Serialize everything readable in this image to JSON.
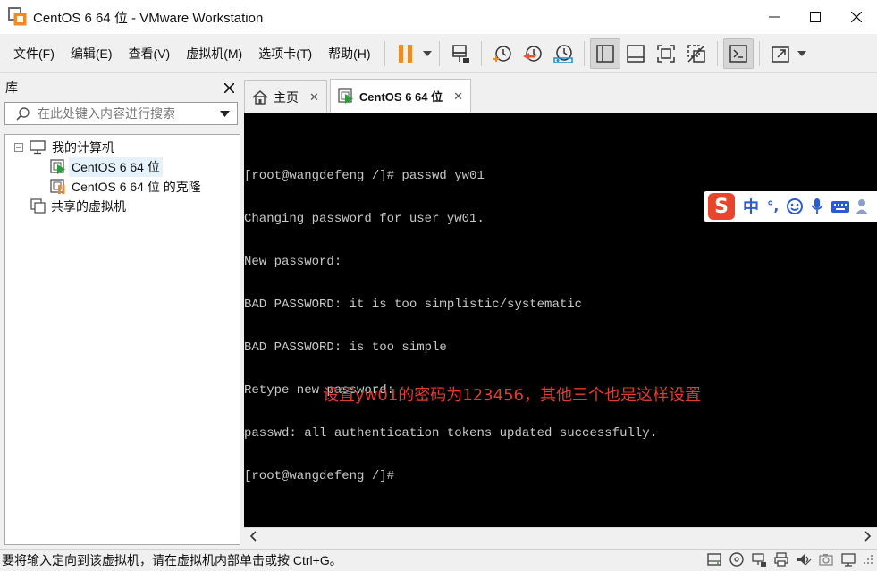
{
  "window": {
    "title": "CentOS 6 64 位 - VMware Workstation"
  },
  "menu": {
    "items": [
      "文件(F)",
      "编辑(E)",
      "查看(V)",
      "虚拟机(M)",
      "选项卡(T)",
      "帮助(H)"
    ]
  },
  "library": {
    "title": "库",
    "search_placeholder": "在此处键入内容进行搜索",
    "tree": {
      "my_computer": "我的计算机",
      "vm1": "CentOS 6 64 位",
      "vm2": "CentOS 6 64 位 的克隆",
      "shared": "共享的虚拟机"
    }
  },
  "tabs": [
    {
      "label": "主页"
    },
    {
      "label": "CentOS 6 64 位"
    }
  ],
  "console": {
    "lines": [
      "[root@wangdefeng /]# passwd yw01",
      "Changing password for user yw01.",
      "New password:",
      "BAD PASSWORD: it is too simplistic/systematic",
      "BAD PASSWORD: is too simple",
      "Retype new password:",
      "passwd: all authentication tokens updated successfully.",
      "[root@wangdefeng /]#"
    ],
    "annotation": "设置yw01的密码为123456，其他三个也是这样设置",
    "annotation_color": "#e23b2d"
  },
  "ime": {
    "logo": "S",
    "mode": "中",
    "punct": "°,"
  },
  "statusbar": {
    "text": "要将输入定向到该虚拟机，请在虚拟机内部单击或按 Ctrl+G。"
  },
  "colors": {
    "pause_accent": "#f08a24",
    "console_bg": "#000000",
    "selection": "#e5f1fb"
  }
}
